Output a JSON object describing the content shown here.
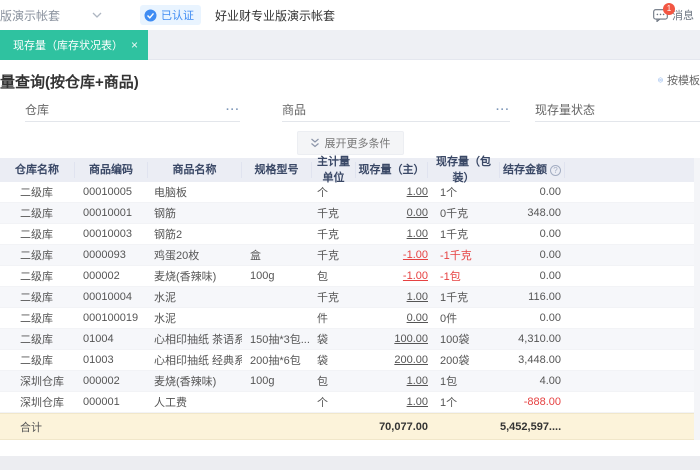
{
  "topbar": {
    "account_select": "好业财专业版演示帐套",
    "verified_badge": "已认证",
    "account_title": "好业财专业版演示帐套",
    "messages_label": "消息",
    "messages_badge": "1"
  },
  "tab": {
    "label": "现存量（库存状况表）",
    "close": "×"
  },
  "page": {
    "title": "现存量查询(按仓库+商品)",
    "template_button": "按模板"
  },
  "filters": {
    "field1_label": "仓库",
    "field2_label": "商品",
    "field3_label": "现存量状态",
    "more_dots": "···",
    "expand_button": "展开更多条件"
  },
  "table": {
    "columns": [
      "仓库名称",
      "商品编码",
      "商品名称",
      "规格型号",
      "主计量单位",
      "现存量（主）",
      "现存量（包装）",
      "结存金额"
    ],
    "help_icon": "?",
    "rows": [
      {
        "warehouse": "二级库",
        "code": "00010005",
        "name": "电脑板",
        "spec": "",
        "unit": "个",
        "qty_main": "1.00",
        "qty_pack": "1个",
        "amount": "0.00",
        "qty_neg": false,
        "amount_neg": false
      },
      {
        "warehouse": "二级库",
        "code": "00010001",
        "name": "钢筋",
        "spec": "",
        "unit": "千克",
        "qty_main": "0.00",
        "qty_pack": "0千克",
        "amount": "348.00",
        "qty_neg": false,
        "amount_neg": false
      },
      {
        "warehouse": "二级库",
        "code": "00010003",
        "name": "钢筋2",
        "spec": "",
        "unit": "千克",
        "qty_main": "1.00",
        "qty_pack": "1千克",
        "amount": "0.00",
        "qty_neg": false,
        "amount_neg": false
      },
      {
        "warehouse": "二级库",
        "code": "0000093",
        "name": "鸡蛋20枚",
        "spec": "盒",
        "unit": "千克",
        "qty_main": "-1.00",
        "qty_pack": "-1千克",
        "amount": "0.00",
        "qty_neg": true,
        "amount_neg": false
      },
      {
        "warehouse": "二级库",
        "code": "000002",
        "name": "麦烧(香辣味)",
        "spec": "100g",
        "unit": "包",
        "qty_main": "-1.00",
        "qty_pack": "-1包",
        "amount": "0.00",
        "qty_neg": true,
        "amount_neg": false
      },
      {
        "warehouse": "二级库",
        "code": "00010004",
        "name": "水泥",
        "spec": "",
        "unit": "千克",
        "qty_main": "1.00",
        "qty_pack": "1千克",
        "amount": "116.00",
        "qty_neg": false,
        "amount_neg": false
      },
      {
        "warehouse": "二级库",
        "code": "000100019",
        "name": "水泥",
        "spec": "",
        "unit": "件",
        "qty_main": "0.00",
        "qty_pack": "0件",
        "amount": "0.00",
        "qty_neg": false,
        "amount_neg": false
      },
      {
        "warehouse": "二级库",
        "code": "01004",
        "name": "心相印抽纸 茶语系列 ...",
        "spec": "150抽*3包...",
        "unit": "袋",
        "qty_main": "100.00",
        "qty_pack": "100袋",
        "amount": "4,310.00",
        "qty_neg": false,
        "amount_neg": false
      },
      {
        "warehouse": "二级库",
        "code": "01003",
        "name": "心相印抽纸 经典系列",
        "spec": "200抽*6包",
        "unit": "袋",
        "qty_main": "200.00",
        "qty_pack": "200袋",
        "amount": "3,448.00",
        "qty_neg": false,
        "amount_neg": false
      },
      {
        "warehouse": "深圳仓库",
        "code": "000002",
        "name": "麦烧(香辣味)",
        "spec": "100g",
        "unit": "包",
        "qty_main": "1.00",
        "qty_pack": "1包",
        "amount": "4.00",
        "qty_neg": false,
        "amount_neg": false
      },
      {
        "warehouse": "深圳仓库",
        "code": "000001",
        "name": "人工费",
        "spec": "",
        "unit": "个",
        "qty_main": "1.00",
        "qty_pack": "1个",
        "amount": "-888.00",
        "qty_neg": false,
        "amount_neg": true
      }
    ],
    "total": {
      "label": "合计",
      "qty_main": "70,077.00",
      "amount": "5,452,597...."
    }
  },
  "colors": {
    "accent_green": "#2fc2a0",
    "verified_blue": "#3f8cf3",
    "negative_red": "#e64242",
    "header_bg": "#ebedf4",
    "total_bg": "#fcf3da",
    "badge_red": "#f25642"
  }
}
